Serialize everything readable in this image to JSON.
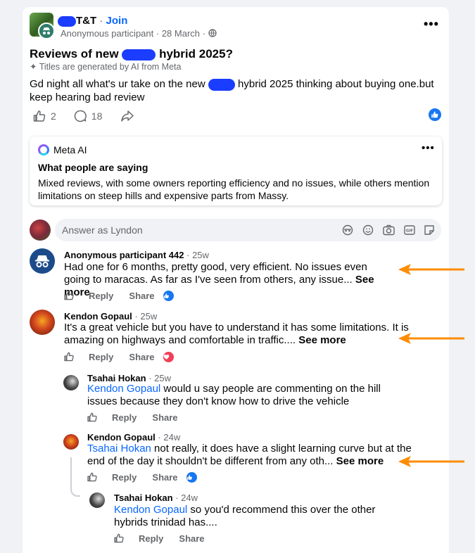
{
  "post": {
    "group_name": "T&T",
    "join_label": "Join",
    "author": "Anonymous participant",
    "date": "28 March",
    "title_pre": "Reviews of new",
    "title_post": "hybrid 2025?",
    "ai_note": "Titles are generated by AI from Meta",
    "body_pre": "Gd night all what's ur take on the new",
    "body_post": "hybrid 2025 thinking about buying one.but keep hearing  bad review",
    "likes": "2",
    "comments": "18"
  },
  "meta_ai": {
    "label": "Meta AI",
    "heading": "What people are saying",
    "summary": "Mixed reviews, with some owners reporting efficiency and no issues, while others mention limitations on steep hills and expensive parts from Massy."
  },
  "composer": {
    "placeholder": "Answer as Lyndon"
  },
  "actions": {
    "reply": "Reply",
    "share": "Share",
    "see_more": "See more"
  },
  "comments": [
    {
      "name": "Anonymous participant 442",
      "time": "25w",
      "text": "Had one for 6 months, pretty good, very efficient. No issues even going to maracas. As far as I've seen from others, any issue..."
    },
    {
      "name": "Kendon Gopaul",
      "time": "25w",
      "text": "It's a great vehicle but you have to understand it has some limitations. It is amazing on highways and comfortable in traffic...."
    },
    {
      "name": "Tsahai Hokan",
      "time": "25w",
      "mention": "Kendon Gopaul",
      "text": " would u say people are commenting on the hill issues because they don't know how to drive the vehicle"
    },
    {
      "name": "Kendon Gopaul",
      "time": "24w",
      "mention": "Tsahai Hokan",
      "text": " not really, it does have a slight learning curve but at the end of the day it shouldn't be different from any oth..."
    },
    {
      "name": "Tsahai Hokan",
      "time": "24w",
      "mention": "Kendon Gopaul",
      "text": " so you'd recommend this over the other hybrids trinidad has...."
    }
  ],
  "colors": {
    "accent": "#0866ff",
    "arrow": "#ff8c00",
    "like": "#1877f2",
    "love": "#f33e58"
  },
  "icons": [
    "globe-icon",
    "more-icon",
    "sparkle-icon",
    "like-icon",
    "comment-icon",
    "share-icon",
    "sticker-icon",
    "emoji-icon",
    "camera-icon",
    "gif-icon",
    "stamp-icon",
    "heart-icon"
  ]
}
